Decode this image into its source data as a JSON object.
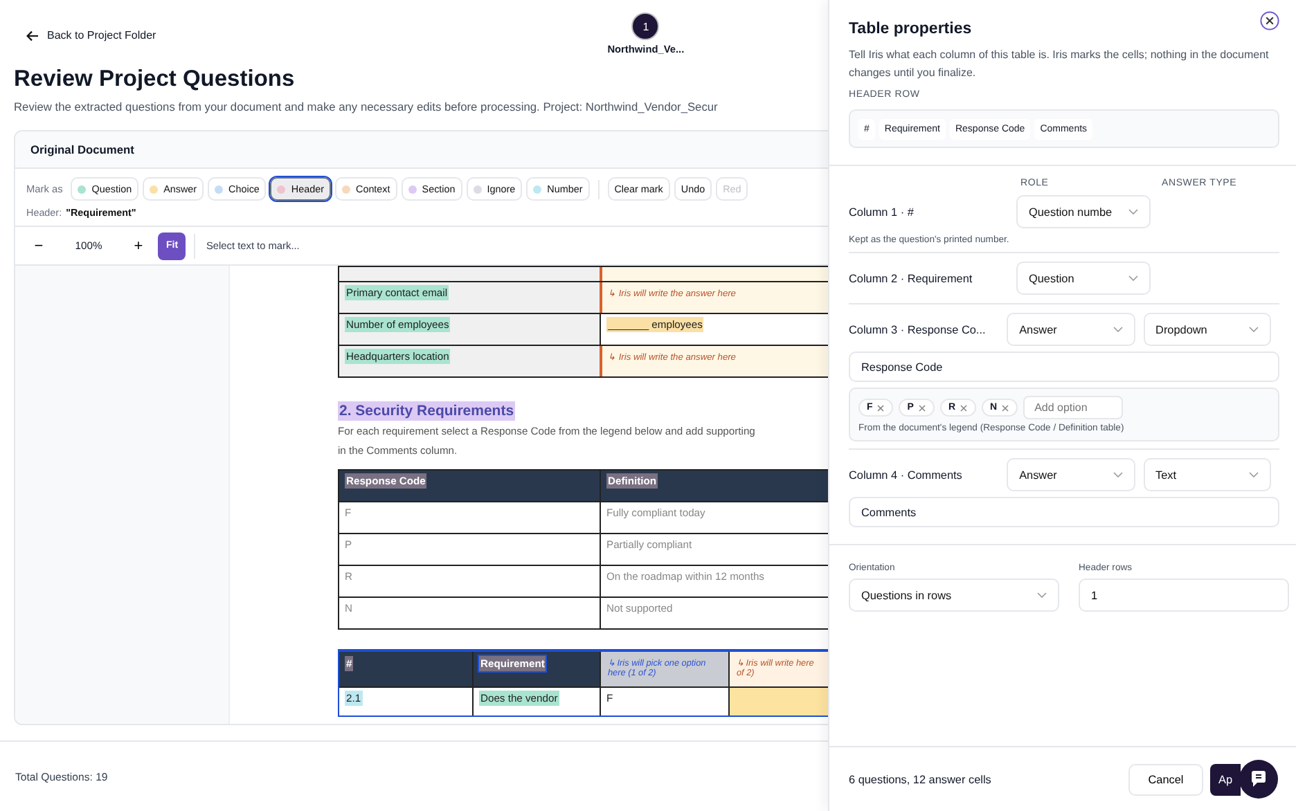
{
  "back_link": {
    "label": "Back to Project Folder"
  },
  "steps": [
    {
      "number": "1",
      "label": "Northwind_Ve...",
      "selected": true
    }
  ],
  "page_title": "Review Project Questions",
  "page_subtitle": "Review the extracted questions from your document and make any necessary edits before processing. Project: Northwind_Vendor_Secur",
  "document": {
    "title": "Original Document",
    "mark_label": "Mark as",
    "marks": [
      {
        "kind": "question",
        "label": "Question",
        "color": "#a9e4d0",
        "selected": false
      },
      {
        "kind": "answer",
        "label": "Answer",
        "color": "#fbe0a6",
        "selected": false
      },
      {
        "kind": "choice",
        "label": "Choice",
        "color": "#c6dcf4",
        "selected": false
      },
      {
        "kind": "header",
        "label": "Header",
        "color": "#f1c3cf",
        "selected": true
      },
      {
        "kind": "context",
        "label": "Context",
        "color": "#f7d8bd",
        "selected": false
      },
      {
        "kind": "section",
        "label": "Section",
        "color": "#dccaf4",
        "selected": false
      },
      {
        "kind": "ignore",
        "label": "Ignore",
        "color": "#dcdce6",
        "selected": false
      },
      {
        "kind": "number",
        "label": "Number",
        "color": "#bde8f1",
        "selected": false
      }
    ],
    "actions": [
      {
        "label": "Clear mark",
        "disabled": false
      },
      {
        "label": "Undo",
        "disabled": false
      },
      {
        "label": "Red",
        "disabled": true
      }
    ],
    "current_mark": {
      "prefix": "Header:",
      "value": "\"Requirement\""
    },
    "zoom": {
      "minus": "−",
      "value": "100%",
      "plus": "+",
      "fit": "Fit",
      "hint": "Select text to mark..."
    },
    "info_rows": [
      {
        "question": "Primary contact email",
        "kind": "iris",
        "answer": "↳ Iris will write the answer here"
      },
      {
        "question": "Number of employees",
        "kind": "blank",
        "answer": "_______ employees"
      },
      {
        "question": "Headquarters location",
        "kind": "iris",
        "answer": "↳ Iris will write the answer here"
      }
    ],
    "section_heading": "2. Security Requirements",
    "section_text": [
      "For each requirement select a Response Code from the legend below and add supporting",
      "in the Comments column."
    ],
    "legend": {
      "headers": [
        "Response Code",
        "Definition"
      ],
      "rows": [
        [
          "F",
          "Fully compliant today"
        ],
        [
          "P",
          "Partially compliant"
        ],
        [
          "R",
          "On the roadmap within 12 months"
        ],
        [
          "N",
          "Not supported"
        ]
      ]
    },
    "requirements": {
      "headers": [
        {
          "kind": "header",
          "text": "#",
          "selected": false
        },
        {
          "kind": "header",
          "text": "Requirement",
          "selected": true
        },
        {
          "kind": "choice",
          "text": "↳ Iris will pick one option here (1 of 2)",
          "selected": false
        },
        {
          "kind": "answer",
          "text": "↳ Iris will write here of 2)",
          "selected": false
        }
      ],
      "rows": [
        [
          "2.1",
          "Does the vendor",
          "F"
        ]
      ]
    }
  },
  "footer": {
    "total": "Total Questions: 19"
  },
  "panel": {
    "title": "Table properties",
    "description": "Tell Iris what each column of this table is. Iris marks the cells; nothing in the document changes until you finalize.",
    "header_row_label": "HEADER ROW",
    "header_row": [
      "#",
      "Requirement",
      "Response Code",
      "Comments"
    ],
    "role_heading": "ROLE",
    "answer_type_heading": "ANSWER TYPE",
    "columns": [
      {
        "label": "Column 1 · #",
        "role": "Question numbe",
        "note": "Kept as the question's printed number."
      },
      {
        "label": "Column 2 · Requirement",
        "role": "Question"
      },
      {
        "label": "Column 3 · Response Co...",
        "role": "Answer",
        "answer_type": "Dropdown",
        "name": "Response Code",
        "options": [
          "F",
          "P",
          "R",
          "N"
        ],
        "add_option_placeholder": "Add option",
        "options_note": "From the document's legend (Response Code / Definition table)"
      },
      {
        "label": "Column 4 · Comments",
        "role": "Answer",
        "answer_type": "Text",
        "name": "Comments"
      }
    ],
    "orientation": {
      "label": "Orientation",
      "value": "Questions in rows"
    },
    "header_rows": {
      "label": "Header rows",
      "value": "1"
    },
    "summary": "6 questions, 12 answer cells",
    "cancel": "Cancel",
    "apply": "Ap"
  }
}
